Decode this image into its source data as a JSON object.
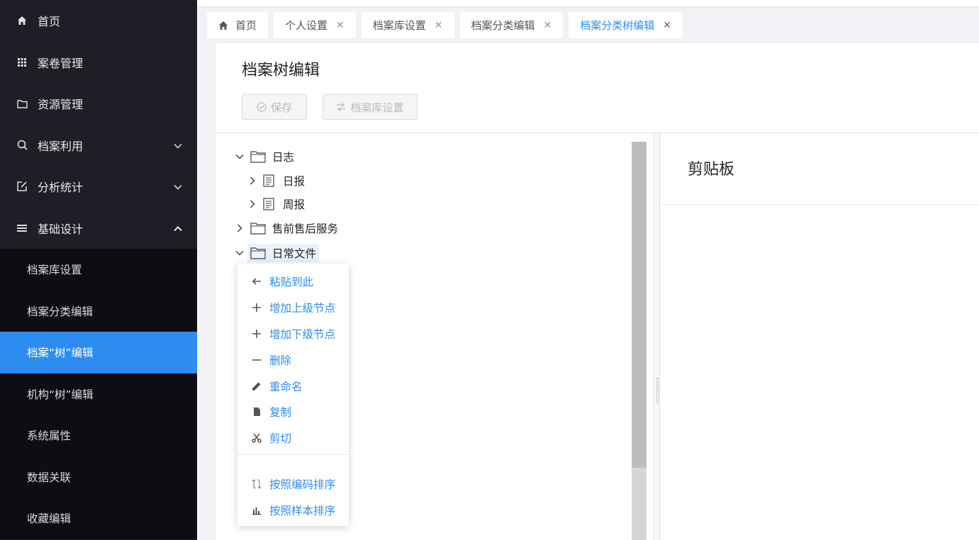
{
  "sidebar": {
    "items": [
      {
        "label": "首页",
        "icon": "home-icon"
      },
      {
        "label": "案卷管理",
        "icon": "grid-icon"
      },
      {
        "label": "资源管理",
        "icon": "folder-icon"
      },
      {
        "label": "档案利用",
        "icon": "search-icon"
      },
      {
        "label": "分析统计",
        "icon": "edit-square-icon"
      },
      {
        "label": "基础设计",
        "icon": "menu-lines-icon"
      }
    ],
    "sub_items": [
      {
        "label": "档案库设置"
      },
      {
        "label": "档案分类编辑"
      },
      {
        "label": "档案“树”编辑"
      },
      {
        "label": "机构“树”编辑"
      },
      {
        "label": "系统属性"
      },
      {
        "label": "数据关联"
      },
      {
        "label": "收藏编辑"
      }
    ],
    "active_sub": "档案“树”编辑"
  },
  "tabs": [
    {
      "label": "首页"
    },
    {
      "label": "个人设置"
    },
    {
      "label": "档案库设置"
    },
    {
      "label": "档案分类编辑"
    },
    {
      "label": "档案分类树编辑"
    }
  ],
  "page": {
    "title": "档案树编辑",
    "save_label": "保存",
    "lib_settings_label": "档案库设置"
  },
  "tree": {
    "nodes": [
      {
        "label": "日志"
      },
      {
        "label": "日报"
      },
      {
        "label": "周报"
      },
      {
        "label": "售前售后服务"
      },
      {
        "label": "日常文件"
      }
    ]
  },
  "context_menu": {
    "items": [
      {
        "label": "粘贴到此",
        "icon": "arrow-left-icon"
      },
      {
        "label": "增加上级节点",
        "icon": "plus-icon"
      },
      {
        "label": "增加下级节点",
        "icon": "plus-icon"
      },
      {
        "label": "删除",
        "icon": "minus-icon"
      },
      {
        "label": "重命名",
        "icon": "pencil-icon"
      },
      {
        "label": "复制",
        "icon": "copy-icon"
      },
      {
        "label": "剪切",
        "icon": "scissors-icon"
      },
      {
        "label": "按照编码排序",
        "icon": "sort-swap-icon"
      },
      {
        "label": "按照样本排序",
        "icon": "bar-chart-icon"
      }
    ]
  },
  "clipboard": {
    "title": "剪贴板"
  },
  "colors": {
    "accent": "#2d8cf0",
    "sidebar_bg": "#1d1e26",
    "submenu_bg": "#0d0d12"
  }
}
